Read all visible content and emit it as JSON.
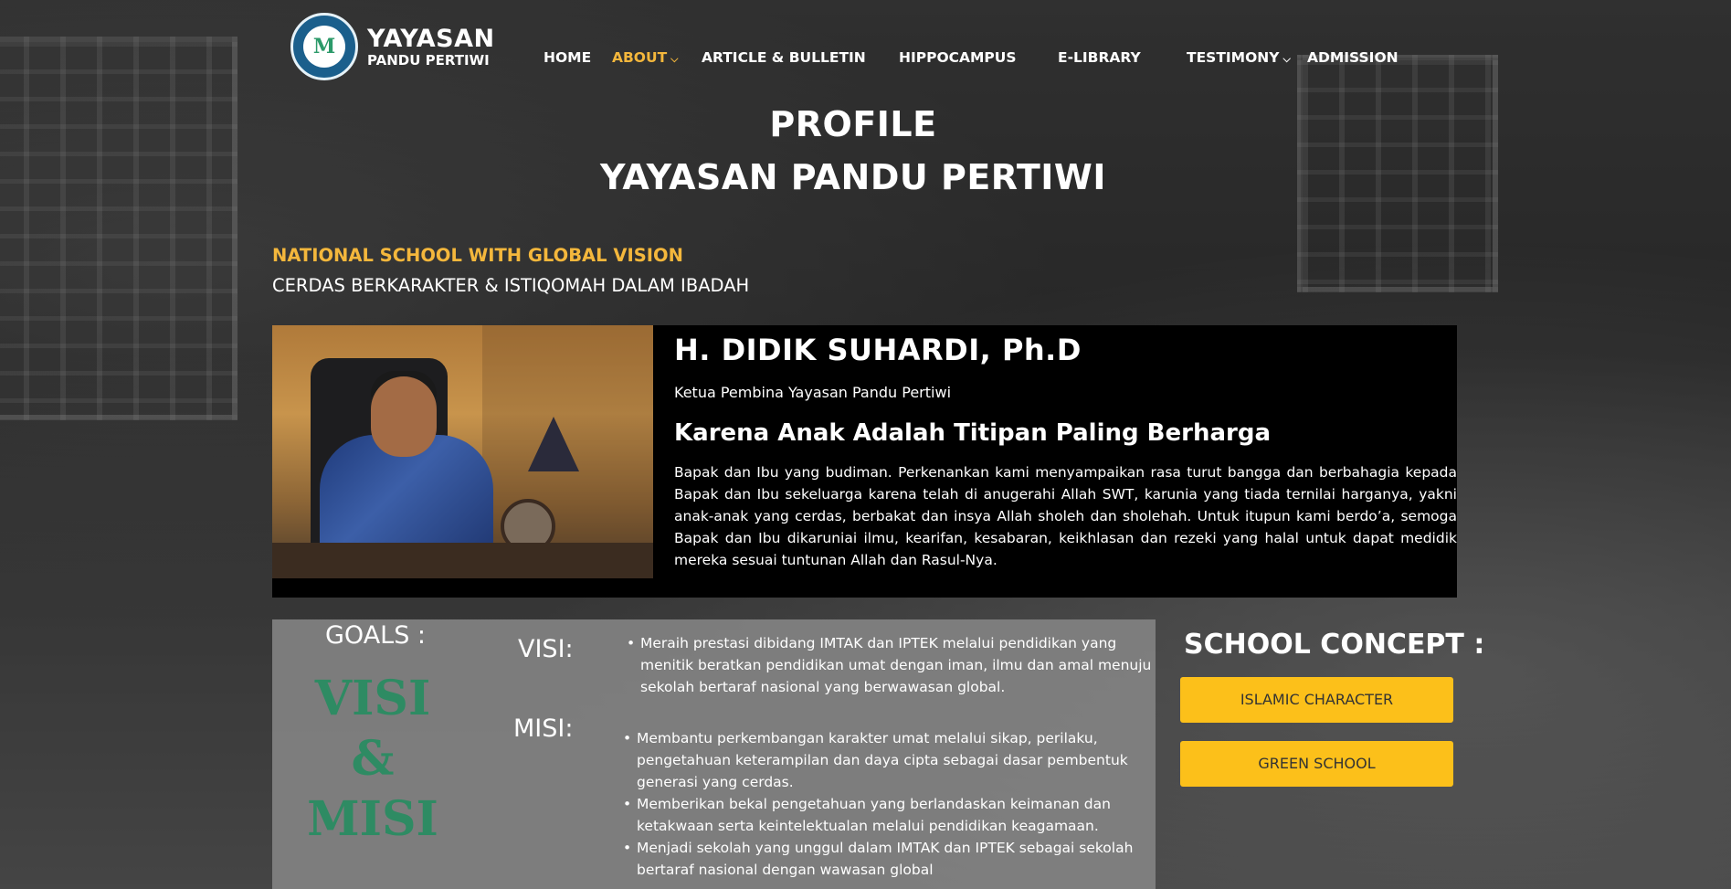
{
  "brand": {
    "line1": "YAYASAN",
    "line2": "PANDU PERTIWI",
    "logo_icon": "yayasan-logo-icon"
  },
  "nav": {
    "items": [
      {
        "label": "HOME",
        "active": false,
        "dropdown": false
      },
      {
        "label": "ABOUT",
        "active": true,
        "dropdown": true
      },
      {
        "label": "ARTICLE & BULLETIN",
        "active": false,
        "dropdown": false
      },
      {
        "label": "HIPPOCAMPUS",
        "active": false,
        "dropdown": false
      },
      {
        "label": "E-LIBRARY",
        "active": false,
        "dropdown": false
      },
      {
        "label": "TESTIMONY",
        "active": false,
        "dropdown": true
      },
      {
        "label": "ADMISSION",
        "active": false,
        "dropdown": false
      }
    ],
    "chevron": "⌵"
  },
  "hero": {
    "title_line1": "PROFILE",
    "title_line2": "YAYASAN PANDU PERTIWI"
  },
  "tagline": {
    "primary": "NATIONAL SCHOOL WITH GLOBAL VISION",
    "secondary": "CERDAS BERKARAKTER & ISTIQOMAH DALAM IBADAH"
  },
  "profile": {
    "name": "H. DIDIK SUHARDI, Ph.D",
    "role": "Ketua Pembina Yayasan Pandu Pertiwi",
    "quote": "Karena Anak Adalah Titipan Paling Berharga",
    "paragraph": "Bapak dan Ibu yang budiman. Perkenankan kami menyampaikan rasa turut bangga dan berbahagia kepada Bapak dan Ibu sekeluarga karena telah di anugerahi Allah SWT, karunia yang tiada ternilai harganya, yakni anak-anak yang cerdas, berbakat dan insya Allah sholeh dan sholehah. Untuk itupun kami berdo’a, semoga Bapak dan Ibu dikaruniai ilmu, kearifan, kesabaran, keikhlasan dan rezeki yang halal untuk dapat medidik mereka sesuai tuntunan Allah dan Rasul-Nya."
  },
  "goals": {
    "label": "GOALS :",
    "vm_line1": "VISI",
    "vm_line2": "&",
    "vm_line3": "MISI",
    "visi_label": "VISI:",
    "misi_label": "MISI:",
    "visi_items": [
      "Meraih prestasi dibidang IMTAK dan IPTEK melalui pendidikan yang menitik beratkan pendidikan umat dengan iman, ilmu dan amal menuju sekolah bertaraf nasional yang berwawasan global."
    ],
    "misi_items": [
      "Membantu perkembangan karakter umat melalui sikap, perilaku, pengetahuan keterampilan dan daya cipta sebagai dasar pembentuk generasi yang cerdas.",
      "Memberikan bekal pengetahuan yang berlandaskan keimanan dan ketakwaan serta keintelektualan melalui pendidikan keagamaan.",
      "Menjadi sekolah yang unggul dalam IMTAK dan IPTEK sebagai sekolah bertaraf nasional dengan wawasan global"
    ]
  },
  "concept": {
    "title": "SCHOOL CONCEPT :",
    "buttons": [
      "ISLAMIC CHARACTER",
      "GREEN SCHOOL"
    ]
  },
  "colors": {
    "accent": "#f4b73c",
    "button": "#fcc01a",
    "vm_green": "#2e8b63",
    "logo_blue": "#1b5f8c"
  }
}
